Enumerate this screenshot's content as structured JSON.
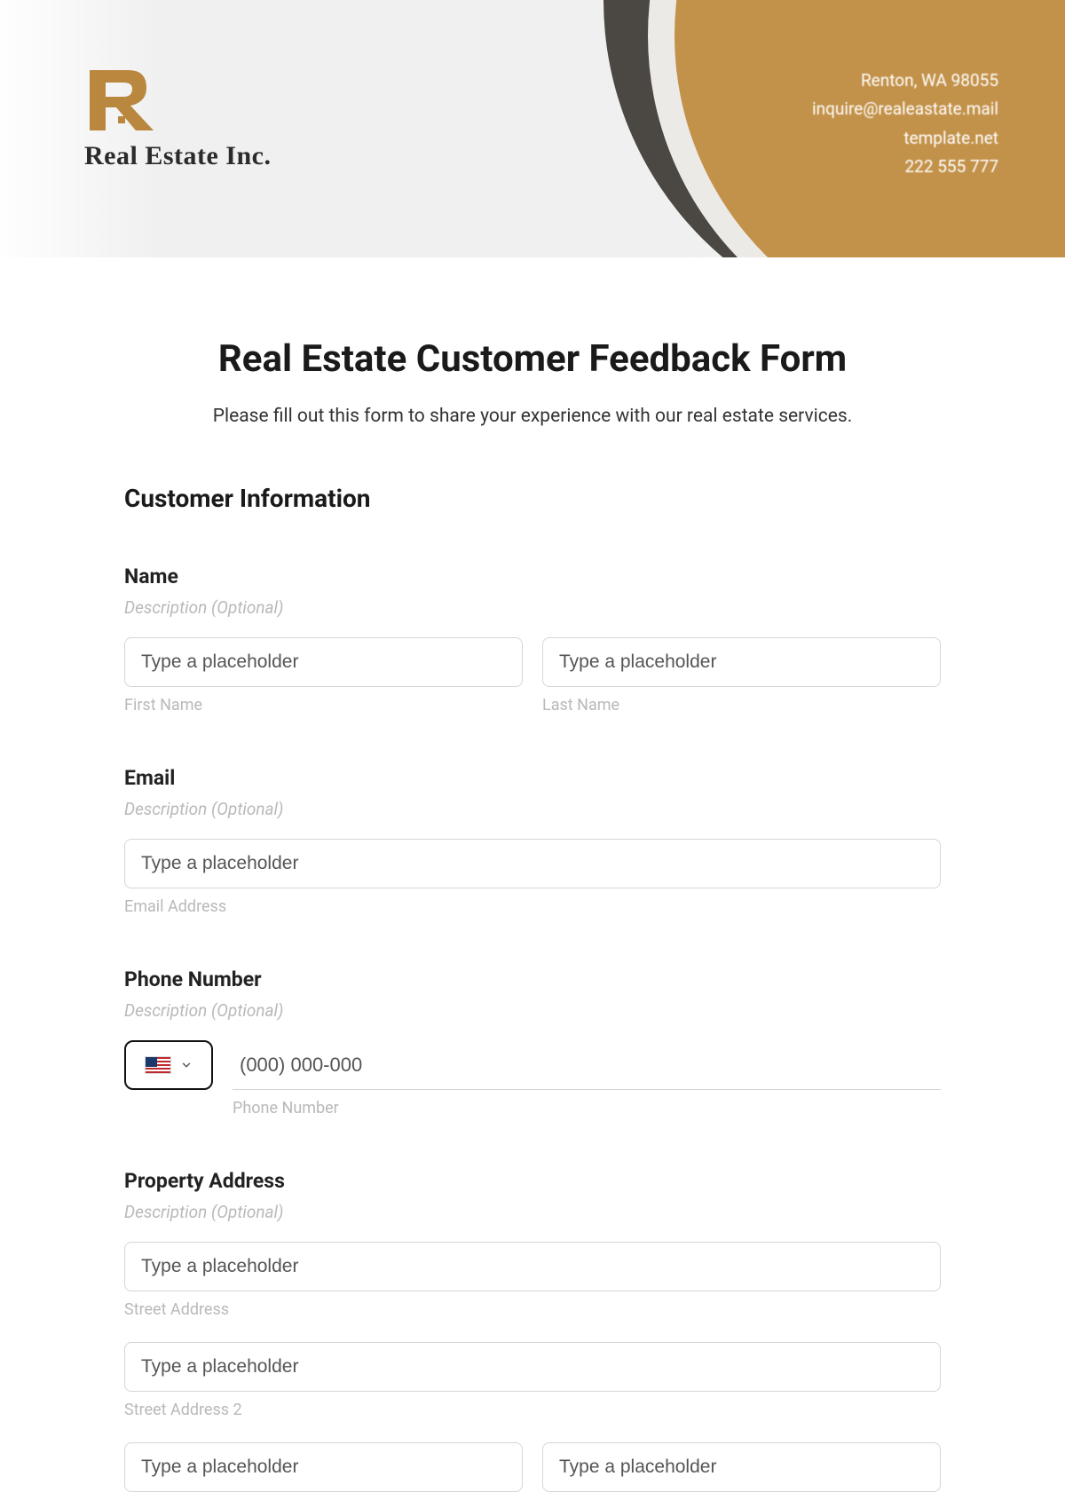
{
  "header": {
    "company_name": "Real Estate Inc.",
    "contact": {
      "city_line": "Renton, WA 98055",
      "email": "inquire@realeastate.mail",
      "site": "template.net",
      "phone": "222 555 777"
    }
  },
  "form": {
    "title": "Real Estate Customer Feedback Form",
    "subtitle": "Please fill out this form to share your experience with our real estate services.",
    "section1_heading": "Customer Information",
    "name": {
      "label": "Name",
      "description": "Description (Optional)",
      "first_placeholder": "Type a placeholder",
      "first_sub": "First Name",
      "last_placeholder": "Type a placeholder",
      "last_sub": "Last Name"
    },
    "email": {
      "label": "Email",
      "description": "Description (Optional)",
      "placeholder": "Type a placeholder",
      "sub": "Email Address"
    },
    "phone": {
      "label": "Phone Number",
      "description": "Description (Optional)",
      "placeholder": "(000) 000-000",
      "sub": "Phone Number"
    },
    "address": {
      "label": "Property Address",
      "description": "Description (Optional)",
      "street1_placeholder": "Type a placeholder",
      "street1_sub": "Street Address",
      "street2_placeholder": "Type a placeholder",
      "street2_sub": "Street Address 2",
      "city_placeholder": "Type a placeholder",
      "state_placeholder": "Type a placeholder"
    }
  }
}
